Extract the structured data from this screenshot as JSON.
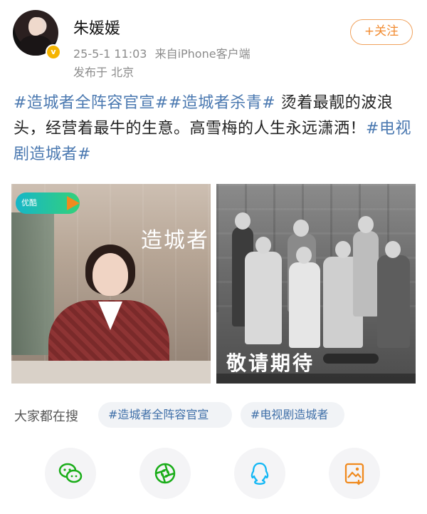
{
  "user": {
    "name": "朱媛媛",
    "time": "25-5-1 11:03",
    "source": "来自iPhone客户端",
    "location": "发布于 北京",
    "follow_label": "+关注"
  },
  "post": {
    "tag1": "#造城者全阵容官宣#",
    "tag2": "#造城者杀青#",
    "text": " 烫着最靓的波浪头，经营着最牛的生意。高雪梅的人生永远潇洒！",
    "tag3": "#电视剧造城者#"
  },
  "images": {
    "left": {
      "logo_text": "优酷",
      "title": "造城者"
    },
    "right": {
      "title": "敬请期待"
    }
  },
  "search": {
    "label": "大家都在搜",
    "chips": [
      "#造城者全阵容官宣",
      "#电视剧造城者"
    ]
  },
  "share": {
    "icons": [
      "wechat-icon",
      "moments-icon",
      "qq-icon",
      "save-image-icon"
    ]
  },
  "colors": {
    "tag_blue": "#4a78b0",
    "follow_orange": "#f28a2e",
    "wechat_green": "#1aad19",
    "qq_blue": "#12b7f5",
    "save_orange": "#f08a1e"
  }
}
